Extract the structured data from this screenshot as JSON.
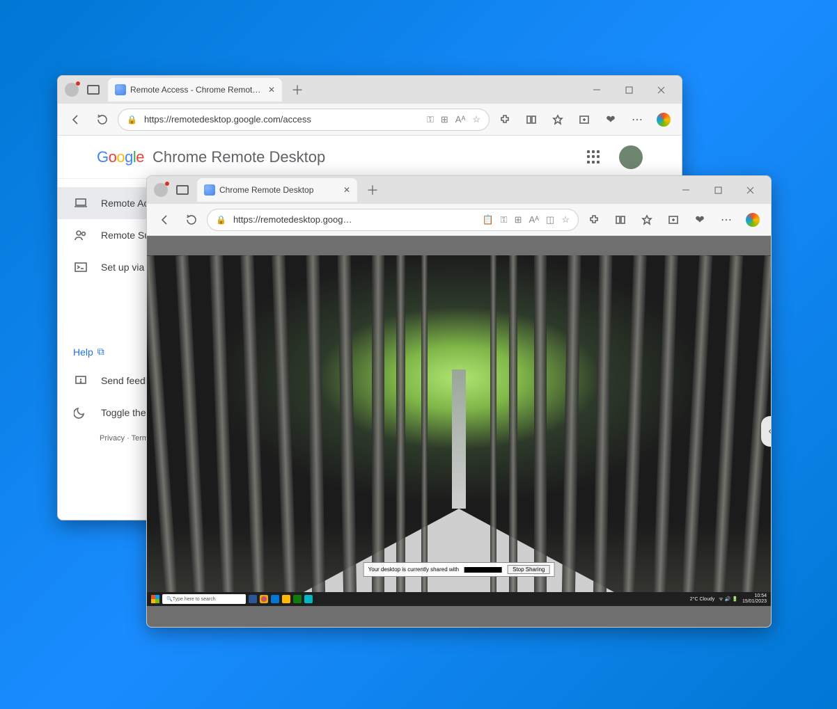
{
  "back": {
    "tab_title": "Remote Access - Chrome Remote…",
    "url": "https://remotedesktop.google.com/access",
    "app_name": "Chrome Remote Desktop",
    "sidebar": {
      "items": [
        {
          "label": "Remote Access"
        },
        {
          "label": "Remote Support"
        },
        {
          "label": "Set up via SSH"
        }
      ],
      "help": "Help",
      "feedback": "Send feedback",
      "theme": "Toggle theme"
    },
    "footer": {
      "privacy": "Privacy",
      "sep": " · ",
      "terms": "Terms"
    }
  },
  "front": {
    "tab_title": "Chrome Remote Desktop",
    "url": "https://remotedesktop.goog…",
    "share_msg": "Your desktop is currently shared with ",
    "stop_label": "Stop Sharing",
    "taskbar": {
      "search_placeholder": "Type here to search",
      "weather": "2°C  Cloudy",
      "time": "10:54",
      "date": "15/01/2023"
    }
  }
}
